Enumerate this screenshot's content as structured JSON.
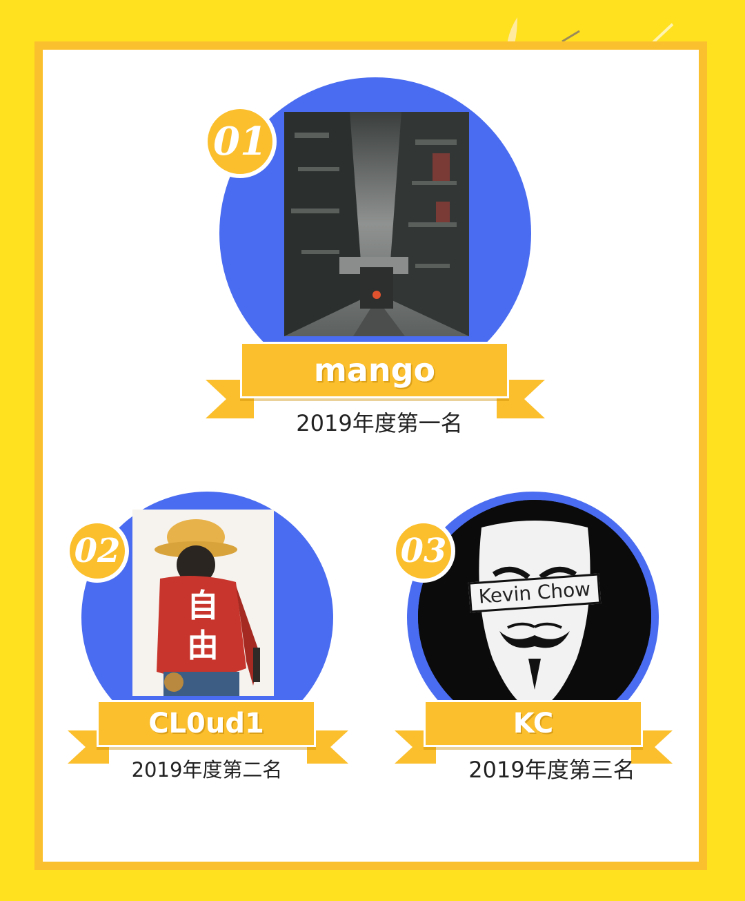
{
  "colors": {
    "background": "#ffe11f",
    "frame_border": "#fbc02d",
    "circle": "#4a6cf0",
    "ribbon": "#fbbf2d",
    "rank_text": "#222222"
  },
  "winners": [
    {
      "badge": "01",
      "name": "mango",
      "rank": "2019年度第一名",
      "avatar_icon": "rainy-city-street-avatar-icon"
    },
    {
      "badge": "02",
      "name": "CL0ud1",
      "rank": "2019年度第二名",
      "avatar_icon": "red-jacket-character-avatar-icon",
      "avatar_text": "自由"
    },
    {
      "badge": "03",
      "name": "KC",
      "rank": "2019年度第三名",
      "avatar_icon": "guy-fawkes-mask-avatar-icon",
      "avatar_text": "Kevin Chow"
    }
  ]
}
